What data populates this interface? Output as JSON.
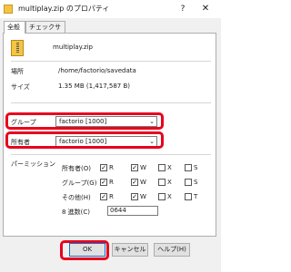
{
  "window": {
    "title": "multiplay.zip のプロパティ",
    "help_label": "?",
    "close_label": "✕"
  },
  "tabs": [
    {
      "label": "全般"
    },
    {
      "label": "チェックサム"
    }
  ],
  "file": {
    "name": "multiplay.zip"
  },
  "info": {
    "location_label": "場所",
    "location_value": "/home/factorio/savedata",
    "size_label": "サイズ",
    "size_value": "1.35 MB (1,417,587 B)"
  },
  "ownership": {
    "group_label": "グループ",
    "group_value": "factorio [1000]",
    "owner_label": "所有者",
    "owner_value": "factorio [1000]"
  },
  "permissions": {
    "section_label": "パーミッション",
    "rows": [
      {
        "label": "所有者(O)",
        "r": true,
        "w": true,
        "x": false,
        "s": false,
        "last_label": "S"
      },
      {
        "label": "グループ(G)",
        "r": true,
        "w": true,
        "x": false,
        "s": false,
        "last_label": "S"
      },
      {
        "label": "その他(H)",
        "r": true,
        "w": true,
        "x": false,
        "s": false,
        "last_label": "T"
      }
    ],
    "col_labels": {
      "r": "R",
      "w": "W",
      "x": "X"
    },
    "octal_label": "8 進数(C)",
    "octal_value": "0644"
  },
  "buttons": {
    "ok": "OK",
    "cancel": "キャンセル",
    "help": "ヘルプ(H)"
  },
  "colors": {
    "highlight": "#e8001c",
    "zip_icon": "#f4c542"
  }
}
